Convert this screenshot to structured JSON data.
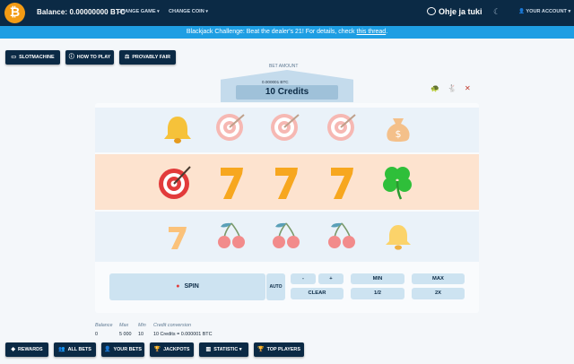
{
  "header": {
    "logo_glyph": "₿",
    "balance": "Balance: 0.00000000 BTC",
    "change_game": "CHANGE GAME",
    "change_coin": "CHANGE COIN",
    "support": "Ohje ja tuki",
    "account": "YOUR ACCOUNT"
  },
  "banner": {
    "text": "Blackjack Challenge: Beat the dealer's 21! For details, check ",
    "link": "this thread",
    "end": "."
  },
  "game_nav": {
    "slotmachine": "SLOTMACHINE",
    "how_to_play": "HOW TO PLAY",
    "provably_fair": "PROVABLY FAIR"
  },
  "bet": {
    "label": "BET AMOUNT",
    "btc": "0.000001 BTC",
    "credits": "10 Credits"
  },
  "reels": {
    "row1": [
      "bell",
      "target",
      "target",
      "target",
      "money-bag"
    ],
    "row2": [
      "target",
      "seven",
      "seven",
      "seven",
      "clover"
    ],
    "row3": [
      "seven",
      "cherries",
      "cherries",
      "cherries",
      "bell"
    ]
  },
  "controls": {
    "spin": "SPIN",
    "auto": "AUTO",
    "minus": "-",
    "plus": "+",
    "min": "MIN",
    "max": "MAX",
    "clear": "CLEAR",
    "half": "1/2",
    "double": "2X"
  },
  "stats": {
    "balance_label": "Balance",
    "balance": "0",
    "max_label": "Max",
    "max": "5 000",
    "min_label": "Min",
    "min": "10",
    "conversion_label": "Credit conversion",
    "conversion": "10 Credits = 0.000001 BTC"
  },
  "footer": {
    "rewards": "REWARDS",
    "all_bets": "ALL BETS",
    "your_bets": "YOUR BETS",
    "jackpots": "JACKPOTS",
    "statistic": "STATISTIC",
    "top_players": "TOP PLAYERS"
  },
  "colors": {
    "navy": "#0b2a45",
    "banner": "#1e9ee3",
    "bitcoin": "#f39b14",
    "win_row": "#fde3cf",
    "reel_row": "#eaf2f9",
    "button": "#cde3f1"
  }
}
